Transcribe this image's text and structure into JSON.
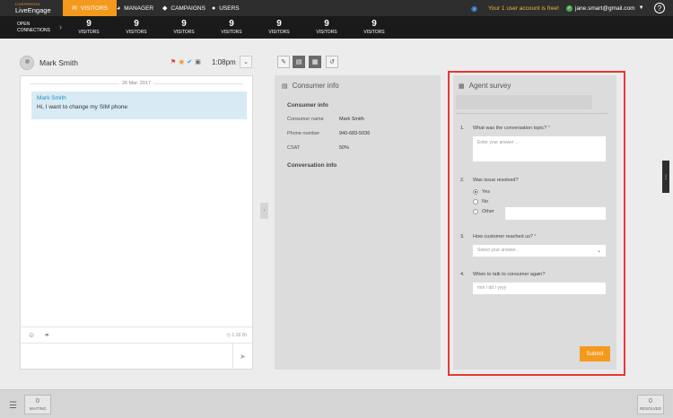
{
  "nav": {
    "logo_brand": "LIVEPERSON",
    "logo_name": "LiveEngage",
    "tabs": [
      {
        "label": "VISITORS",
        "icon": "chat-icon"
      },
      {
        "label": "MANAGER",
        "icon": "pie-chart-icon"
      },
      {
        "label": "CAMPAIGNS",
        "icon": "tag-icon"
      },
      {
        "label": "USERS",
        "icon": "user-icon"
      }
    ],
    "promo": "Your 1 user account is free!",
    "user_email": "jane.smart@gmail.com",
    "help": "?"
  },
  "stats": {
    "open_connections_line1": "OPEN",
    "open_connections_line2": "CONNECTIONS",
    "items": [
      {
        "value": "9",
        "label": "VISITORS"
      },
      {
        "value": "9",
        "label": "VISITORS"
      },
      {
        "value": "9",
        "label": "VISITORS"
      },
      {
        "value": "9",
        "label": "VISITORS"
      },
      {
        "value": "9",
        "label": "VISITORS"
      },
      {
        "value": "9",
        "label": "VISITORS"
      },
      {
        "value": "9",
        "label": "VISITORS"
      }
    ]
  },
  "chat": {
    "consumer_name": "Mark Smith",
    "time": "1:08pm",
    "date": "26 Mar. 2017",
    "message": {
      "sender": "Mark Smith",
      "text": "Hi, I want to change my SIM phone"
    },
    "timestamp": "1:18 2h"
  },
  "consumer_info": {
    "title": "Consumer info",
    "section1": "Consumer info",
    "rows": [
      {
        "key": "Consumer name",
        "value": "Mark Smith"
      },
      {
        "key": "Phone number",
        "value": "940-683-5036"
      },
      {
        "key": "CSAT",
        "value": "50%"
      }
    ],
    "section2": "Conversation info"
  },
  "survey": {
    "title": "Agent survey",
    "q1": {
      "num": "1.",
      "label": "What was the conversation topic?",
      "required": "*",
      "placeholder": "Enter your answer ..."
    },
    "q2": {
      "num": "2.",
      "label": "Was issue resolved?",
      "options": [
        "Yes",
        "No",
        "Other"
      ],
      "selected": "Yes"
    },
    "q3": {
      "num": "3.",
      "label": "How customer reached us?",
      "required": "*",
      "placeholder": "Select your answer..."
    },
    "q4": {
      "num": "4.",
      "label": "When to talk to consumer again?",
      "placeholder": "mm / dd / yyyy"
    },
    "submit": "Submit"
  },
  "bottom": {
    "waiting": {
      "value": "0",
      "label": "WAITING"
    },
    "resolved": {
      "value": "0",
      "label": "RESOLVED"
    }
  }
}
